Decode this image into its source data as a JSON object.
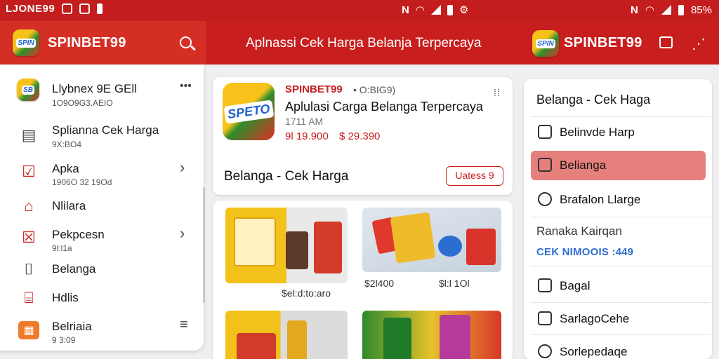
{
  "status_bar": {
    "left_text": "LJONE99",
    "icons": [
      "notification-icon",
      "image-icon",
      "battery-saver-icon"
    ],
    "mid_icons": [
      "mute-icon",
      "wifi-icon",
      "signal-icon",
      "battery-icon",
      "settings-icon"
    ],
    "right_battery": "85%"
  },
  "appbar": {
    "left_brand": "SPINBET99",
    "center_title": "Aplnassi Cek Harga Belanja Terpercaya",
    "right_brand": "SPINBET99",
    "colors": {
      "primary": "#c81e1e",
      "left_section": "#d52f25",
      "accent": "#ef7a2a"
    }
  },
  "drawer": {
    "items": [
      {
        "icon": "app-logo-icon",
        "title": "Llybnex 9E GEll",
        "subtitle": "1O9O9G3.AEIO",
        "trailing": "•••"
      },
      {
        "icon": "wallet-icon",
        "title": "Splianna Cek Harga",
        "subtitle": "9X:BO4",
        "trailing": ""
      },
      {
        "icon": "clipboard-icon",
        "title": "Apka",
        "subtitle": "1906O 32 19Od",
        "trailing": "›"
      },
      {
        "icon": "shirt-icon",
        "title": "Nlilara",
        "subtitle": "",
        "trailing": ""
      },
      {
        "icon": "checkbox-icon",
        "title": "Pekpcesn",
        "subtitle": "9l:l1a",
        "trailing": "›"
      },
      {
        "icon": "shopping-bag-icon",
        "title": "Belanga",
        "subtitle": "",
        "trailing": ""
      },
      {
        "icon": "bag-icon",
        "title": "Hdlis",
        "subtitle": "",
        "trailing": ""
      },
      {
        "icon": "store-icon",
        "title": "Belriaia",
        "subtitle": "9 3:09",
        "trailing": "≡"
      }
    ]
  },
  "main_card": {
    "brand": "SPINBET99",
    "meta": "• O:BIG9)",
    "title": "Aplulasi Carga Belanga Terpercaya",
    "time": "1711 AM",
    "price_old": "9l 19.900",
    "price_new": "$ 29.390",
    "section_title": "Belanga - Cek Harga",
    "button_label": "Uatess 9"
  },
  "product_grid": {
    "items": [
      {
        "label": "$el:d:to:aro"
      },
      {
        "label": "$2l400"
      },
      {
        "label": "$l:l 1Ol"
      },
      {
        "label": ""
      }
    ]
  },
  "right_panel": {
    "header": "Belanga - Cek Haga",
    "items": [
      {
        "icon": "bookmark-icon",
        "label": "Belinvde Harp",
        "active": false
      },
      {
        "icon": "edit-icon",
        "label": "Belianga",
        "active": true
      },
      {
        "icon": "search-icon",
        "label": "Brafalon Llarge",
        "active": false
      }
    ],
    "section_head": "Ranaka Kairqan",
    "section_link": "CEK NIMOOIS :449",
    "more_items": [
      {
        "icon": "folder-icon",
        "label": "Bagal"
      },
      {
        "icon": "tag-icon",
        "label": "SarlagoCehe"
      },
      {
        "icon": "heart-icon",
        "label": "Sorlepedaqe"
      }
    ]
  }
}
